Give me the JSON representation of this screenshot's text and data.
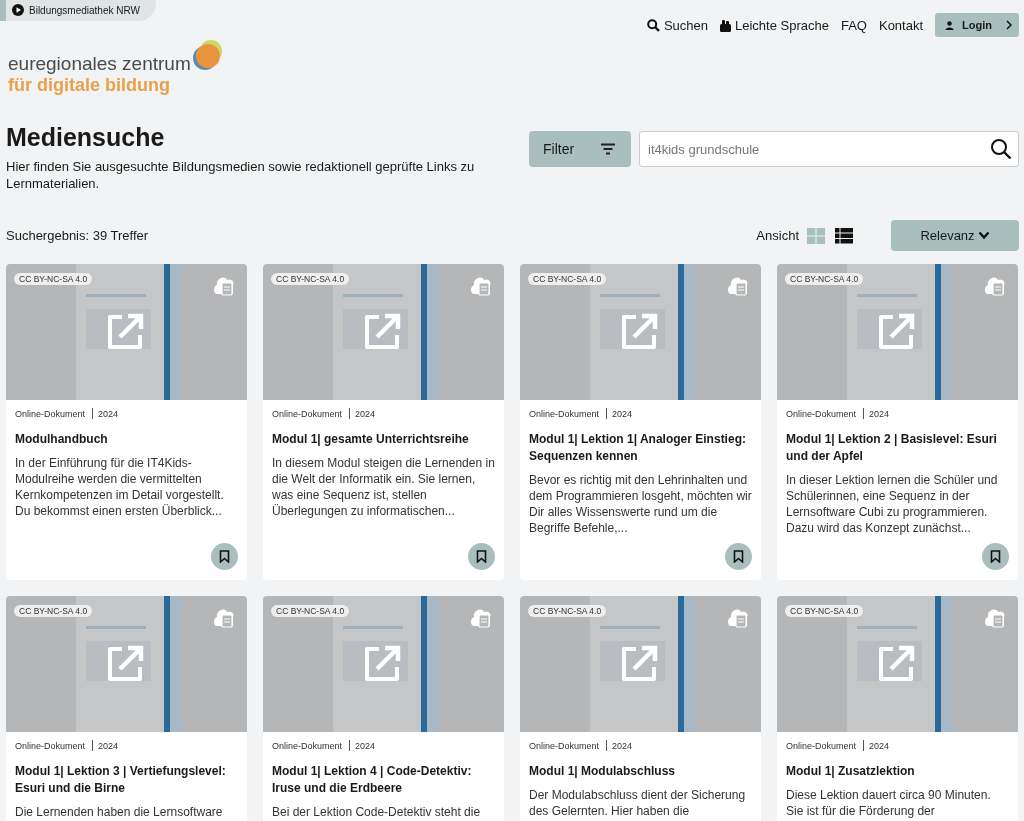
{
  "portal_tab": {
    "label": "Bildungsmediathek NRW"
  },
  "nav": [
    {
      "kind": "search",
      "label": "Suchen"
    },
    {
      "kind": "easy",
      "label": "Leichte Sprache"
    },
    {
      "kind": "plain",
      "label": "FAQ"
    },
    {
      "kind": "plain",
      "label": "Kontakt"
    }
  ],
  "login": {
    "label": "Login"
  },
  "logo": {
    "line_1": "euregionales zentrum",
    "line_2": "für digitale bildung"
  },
  "page": {
    "title": "Mediensuche",
    "intro": "Hier finden Sie ausgesuchte Bildungsmedien sowie redaktionell geprüfte Links zu Lernmaterialien."
  },
  "filter": {
    "label": "Filter"
  },
  "search": {
    "value": "it4kids grundschule"
  },
  "results": {
    "count": "Suchergebnis: 39 Treffer",
    "view_label": "Ansicht",
    "sort": "Relevanz"
  },
  "views": [
    {
      "kind": "grid",
      "selected": false
    },
    {
      "kind": "list",
      "selected": true
    }
  ],
  "cards": [
    {
      "license": "CC BY-NC-SA 4.0",
      "type": "Online-Dokument",
      "year": "2024",
      "title": "Modulhandbuch",
      "description": "In der Einführung für die IT4Kids-Modulreihe werden die vermittelten Kernkompetenzen im Detail vorgestellt. Du bekommst einen ersten Überblick..."
    },
    {
      "license": "CC BY-NC-SA 4.0",
      "type": "Online-Dokument",
      "year": "2024",
      "title": "Modul 1| gesamte Unterrichtsreihe",
      "description": "In diesem Modul steigen die Lernenden in die Welt der Informatik ein. Sie lernen, was eine Sequenz ist, stellen Überlegungen zu informatischen..."
    },
    {
      "license": "CC BY-NC-SA 4.0",
      "type": "Online-Dokument",
      "year": "2024",
      "title": "Modul 1| Lektion 1| Analoger Einstieg: Sequenzen kennen",
      "description": "Bevor es richtig mit den Lehrinhalten und dem Programmieren losgeht, möchten wir Dir alles Wissenswerte rund um die Begriffe Befehle,..."
    },
    {
      "license": "CC BY-NC-SA 4.0",
      "type": "Online-Dokument",
      "year": "2024",
      "title": "Modul 1| Lektion 2 | Basislevel: Esuri und der Apfel",
      "description": "In dieser Lektion lernen die Schüler und Schülerinnen, eine Sequenz in der Lernsoftware Cubi zu programmieren. Dazu wird das Konzept zunächst..."
    },
    {
      "license": "CC BY-NC-SA 4.0",
      "type": "Online-Dokument",
      "year": "2024",
      "title": "Modul 1| Lektion 3 | Vertiefungslevel: Esuri und die Birne",
      "description": "Die Lernenden haben die Lernsoftware"
    },
    {
      "license": "CC BY-NC-SA 4.0",
      "type": "Online-Dokument",
      "year": "2024",
      "title": "Modul 1| Lektion 4 | Code-Detektiv: Iruse und die Erdbeere",
      "description": "Bei der Lektion Code-Detektiv steht die"
    },
    {
      "license": "CC BY-NC-SA 4.0",
      "type": "Online-Dokument",
      "year": "2024",
      "title": "Modul 1| Modulabschluss",
      "description": "Der Modulabschluss dient der Sicherung des Gelernten. Hier haben die"
    },
    {
      "license": "CC BY-NC-SA 4.0",
      "type": "Online-Dokument",
      "year": "2024",
      "title": "Modul 1| Zusatzlektion",
      "description": "Diese Lektion dauert circa 90 Minuten. Sie ist für die Förderung der"
    }
  ]
}
